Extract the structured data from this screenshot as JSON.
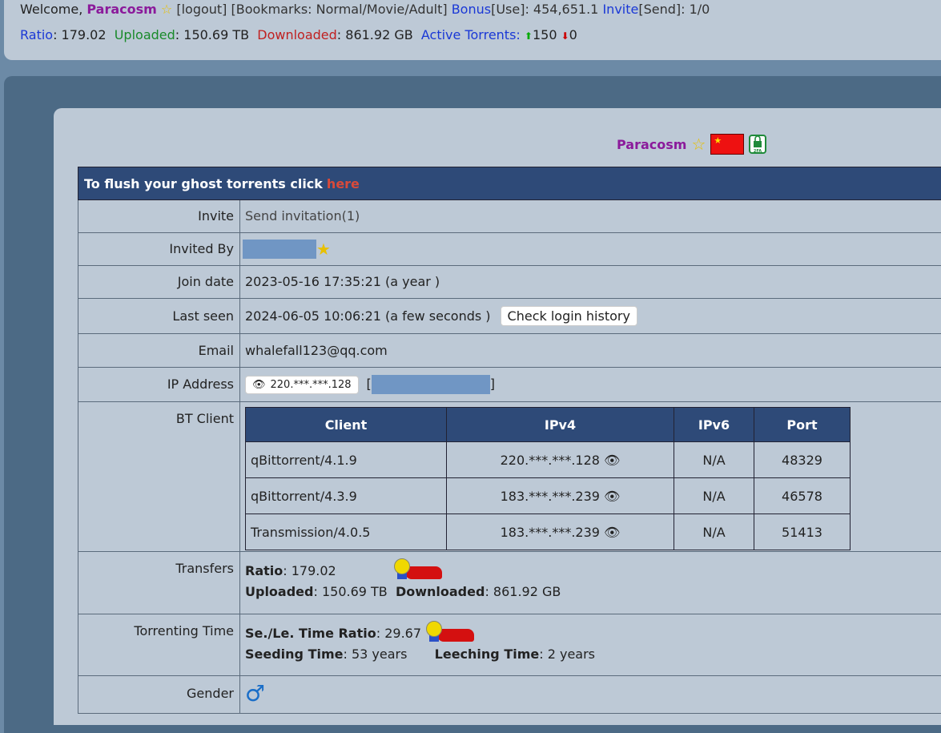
{
  "topbar": {
    "welcome": "Welcome, ",
    "username": "Paracosm",
    "logout": "[logout]",
    "bookmarks_label": "[Bookmarks:",
    "bookmarks_items": "Normal/Movie/Adult]",
    "bonus_label": "Bonus",
    "bonus_use": "[Use]: 454,651.1",
    "invite_label": "Invite",
    "invite_send": "[Send]: 1/0",
    "ratio_label": "Ratio",
    "ratio_value": ": 179.02",
    "uploaded_label": "Uploaded",
    "uploaded_value": ": 150.69 TB",
    "downloaded_label": "Downloaded",
    "downloaded_value": ": 861.92 GB",
    "active_label": "Active Torrents:",
    "active_up": "150",
    "active_down": "0"
  },
  "profile": {
    "username": "Paracosm",
    "badge_2fa_label": "2FA"
  },
  "banner": {
    "text": "To flush your ghost torrents click",
    "link": "here"
  },
  "rows": {
    "invite": {
      "label": "Invite",
      "value": "Send invitation(1)"
    },
    "invited_by": {
      "label": "Invited By"
    },
    "join_date": {
      "label": "Join date",
      "value": "2023-05-16 17:35:21 (a year )"
    },
    "last_seen": {
      "label": "Last seen",
      "value": "2024-06-05 10:06:21 (a few seconds )",
      "button": "Check login history"
    },
    "email": {
      "label": "Email",
      "value": "whalefall123@qq.com"
    },
    "ip": {
      "label": "IP Address",
      "value": "220.***.***.128",
      "bracket_open": "[",
      "bracket_close": "]"
    },
    "bt_client": {
      "label": "BT Client"
    },
    "transfers": {
      "label": "Transfers",
      "ratio_label": "Ratio",
      "ratio_value": ": 179.02",
      "uploaded_label": "Uploaded",
      "uploaded_value": ": 150.69 TB",
      "downloaded_label": "Downloaded",
      "downloaded_value": ": 861.92 GB"
    },
    "torrenting": {
      "label": "Torrenting Time",
      "ratio_label": "Se./Le. Time Ratio",
      "ratio_value": ": 29.67",
      "seeding_label": "Seeding Time",
      "seeding_value": ": 53 years",
      "leeching_label": "Leeching Time",
      "leeching_value": ": 2 years"
    },
    "gender": {
      "label": "Gender",
      "symbol": "♂"
    }
  },
  "bt_table": {
    "headers": [
      "Client",
      "IPv4",
      "IPv6",
      "Port"
    ],
    "rows": [
      {
        "client": "qBittorrent/4.1.9",
        "ipv4": "220.***.***.128",
        "ipv6": "N/A",
        "port": "48329"
      },
      {
        "client": "qBittorrent/4.3.9",
        "ipv4": "183.***.***.239",
        "ipv6": "N/A",
        "port": "46578"
      },
      {
        "client": "Transmission/4.0.5",
        "ipv4": "183.***.***.239",
        "ipv6": "N/A",
        "port": "51413"
      }
    ]
  },
  "colors": {
    "header_bg": "#2e4a78",
    "panel_bg": "#bdc9d6",
    "username": "#8b1a9b",
    "link_red": "#d94a3a",
    "mask_blue": "#7096c4"
  }
}
